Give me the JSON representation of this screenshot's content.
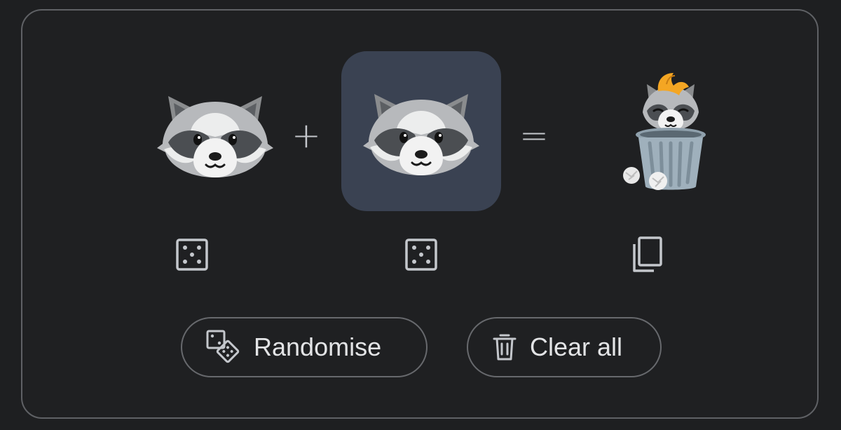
{
  "mixer": {
    "left_emoji": "raccoon",
    "right_emoji": "raccoon",
    "result_emoji": "raccoon in trash can",
    "plus_symbol": "+",
    "equals_symbol": "="
  },
  "icons": {
    "left_random": "dice-icon",
    "right_random": "dice-icon",
    "copy": "copy-icon"
  },
  "actions": {
    "randomise_label": "Randomise",
    "clear_label": "Clear all"
  },
  "colors": {
    "background": "#1e1f21",
    "selected_slot": "#3a4252",
    "border": "#5f6165",
    "text": "#e3e4e6",
    "flame": "#f4a623"
  }
}
